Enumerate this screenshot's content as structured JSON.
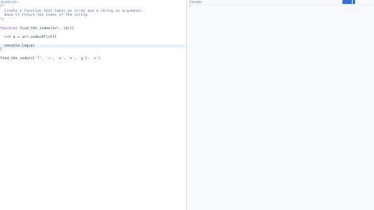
{
  "editor": {
    "language_tab": "JavaScript",
    "tab_caret": "▾",
    "lines": [
      "/*",
      "  Create a function that takes an array and a string as arguments.",
      "  Have it return the index of the string.",
      "*/",
      "",
      "function find_the_index(arr, str){",
      "",
      "  let a = arr.indexOf(str)",
      "",
      "  console.log(a)",
      "}",
      "",
      "find_the_index(['f', 'i', 'a', 'n', 'g'], 'a')"
    ]
  },
  "console": {
    "title": "Console",
    "prompt": "›",
    "run_icon": "run-icon",
    "clear_icon": "clear-icon"
  },
  "colors": {
    "accent": "#2e6fd8",
    "comment": "#5b6a9e",
    "keyword": "#8f2dbb",
    "string": "#a04040",
    "active_line": "#eaf2ff"
  }
}
